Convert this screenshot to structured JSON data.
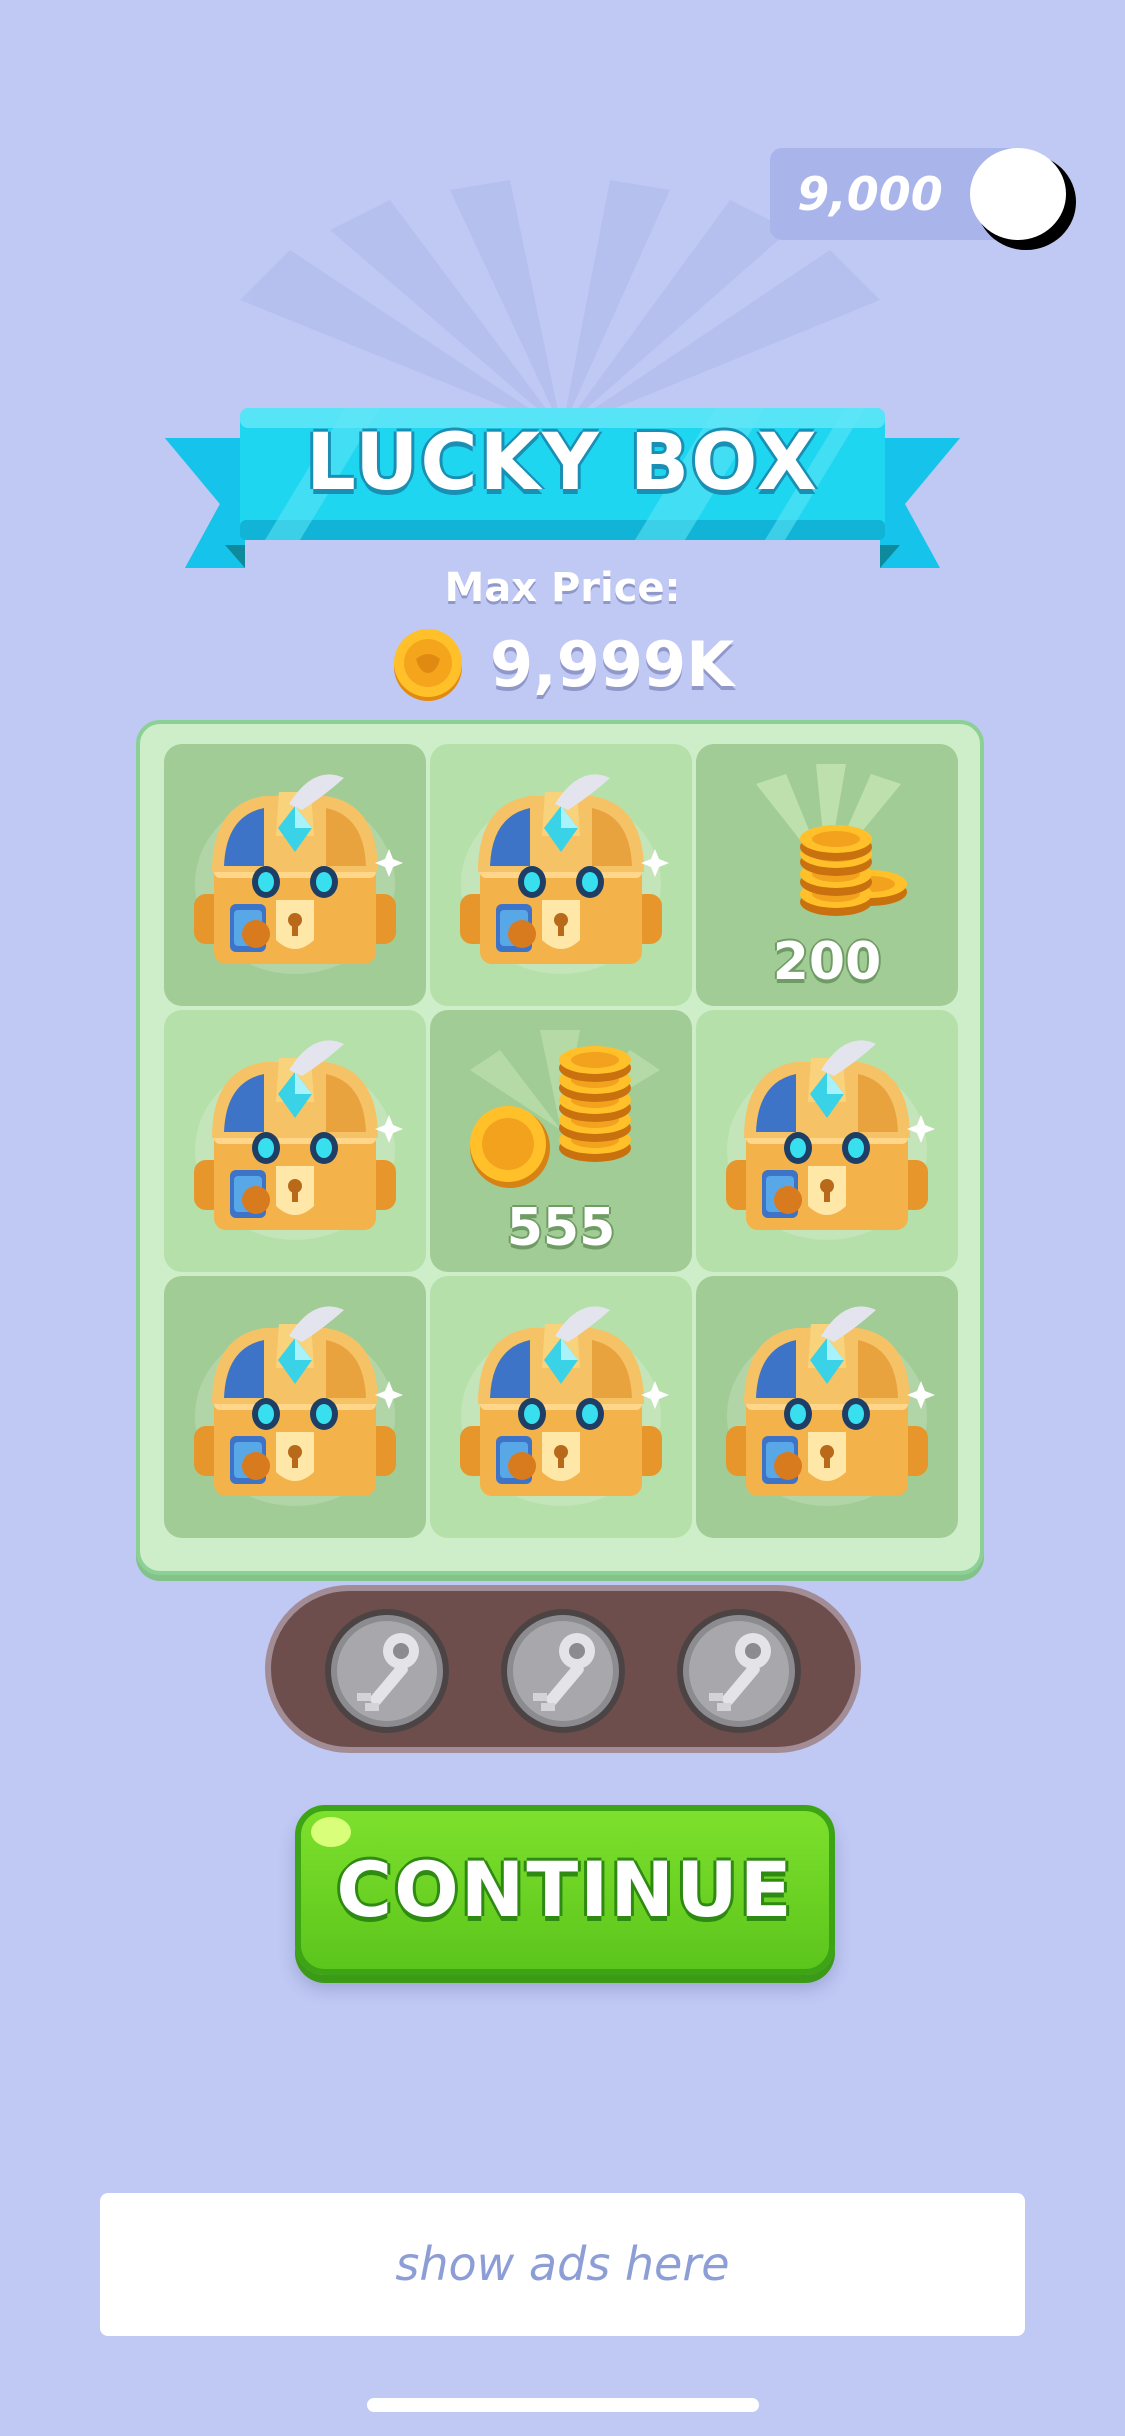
{
  "coins": {
    "balance": "9,000"
  },
  "banner": {
    "title": "LUCKY BOX"
  },
  "max_price": {
    "label": "Max Price:",
    "value": "9,999K"
  },
  "board": {
    "cells": [
      {
        "type": "chest",
        "amount": ""
      },
      {
        "type": "chest",
        "amount": ""
      },
      {
        "type": "coins",
        "amount": "200"
      },
      {
        "type": "chest",
        "amount": ""
      },
      {
        "type": "coins",
        "amount": "555"
      },
      {
        "type": "chest",
        "amount": ""
      },
      {
        "type": "chest",
        "amount": ""
      },
      {
        "type": "chest",
        "amount": ""
      },
      {
        "type": "chest",
        "amount": ""
      }
    ]
  },
  "keys": {
    "count": 3,
    "icon": "silver-key-icon"
  },
  "continue_button": {
    "label": "CONTINUE"
  },
  "ad": {
    "text": "show ads here"
  },
  "colors": {
    "background": "#c0c8f4",
    "banner": "#1fd6f0",
    "board": "#cdeec8",
    "button": "#6fd628"
  }
}
